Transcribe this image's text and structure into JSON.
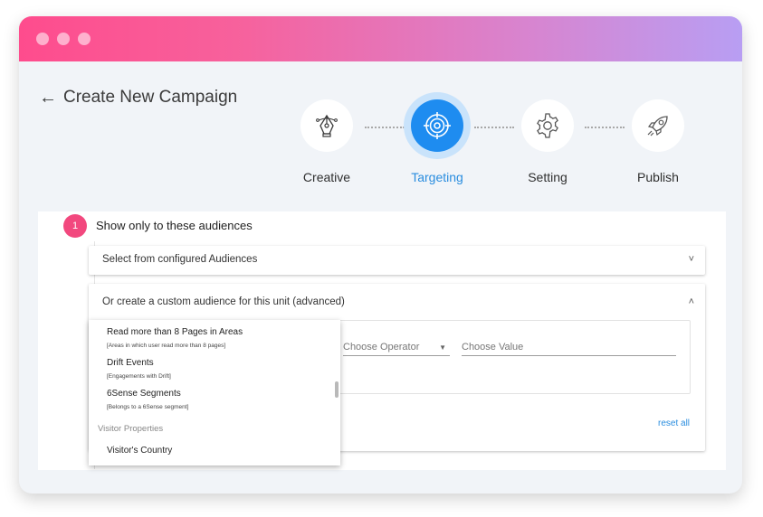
{
  "window": {
    "controls": [
      "close-dot",
      "minimize-dot",
      "maximize-dot"
    ]
  },
  "header": {
    "back_arrow": "←",
    "title": "Create New Campaign"
  },
  "steps": [
    {
      "label": "Creative",
      "icon": "pen-tool-icon",
      "active": false
    },
    {
      "label": "Targeting",
      "icon": "target-icon",
      "active": true
    },
    {
      "label": "Setting",
      "icon": "gear-icon",
      "active": false
    },
    {
      "label": "Publish",
      "icon": "rocket-icon",
      "active": false
    }
  ],
  "section": {
    "number": "1",
    "title": "Show only to these audiences"
  },
  "configured": {
    "label": "Select from configured Audiences",
    "chevron": "˅"
  },
  "custom": {
    "label": "Or create a custom audience for this unit (advanced)",
    "chevron": "˄",
    "operator_placeholder": "Choose Operator",
    "value_placeholder": "Choose Value",
    "reset_label": "reset all"
  },
  "dropdown": {
    "items": [
      {
        "label": "Read more than 8 Pages in Areas",
        "sub": "[Areas in which user read more than 8 pages]"
      },
      {
        "label": "Drift Events",
        "sub": "[Engagements with Drift]"
      },
      {
        "label": "6Sense Segments",
        "sub": "[Belongs to a 6Sense segment]"
      }
    ],
    "group_label": "Visitor Properties",
    "group_items": [
      "Visitor's Country"
    ]
  },
  "colors": {
    "accent": "#1e8cf0",
    "badge": "#f2487e",
    "titlebar_start": "#fe4c8d",
    "titlebar_end": "#b89ef3"
  }
}
